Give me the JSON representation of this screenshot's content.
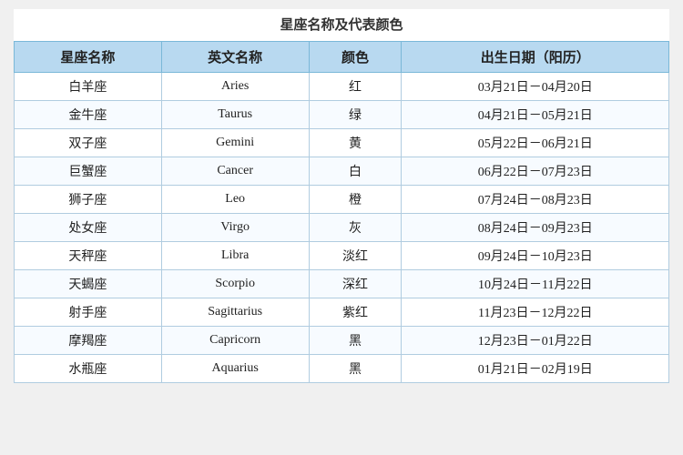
{
  "page": {
    "title": "星座名称及代表颜色",
    "headers": [
      "星座名称",
      "英文名称",
      "颜色",
      "出生日期（阳历）"
    ],
    "rows": [
      {
        "chinese": "白羊座",
        "english": "Aries",
        "color": "红",
        "dates": "03月21日－04月20日"
      },
      {
        "chinese": "金牛座",
        "english": "Taurus",
        "color": "绿",
        "dates": "04月21日－05月21日"
      },
      {
        "chinese": "双子座",
        "english": "Gemini",
        "color": "黄",
        "dates": "05月22日－06月21日"
      },
      {
        "chinese": "巨蟹座",
        "english": "Cancer",
        "color": "白",
        "dates": "06月22日－07月23日"
      },
      {
        "chinese": "狮子座",
        "english": "Leo",
        "color": "橙",
        "dates": "07月24日－08月23日"
      },
      {
        "chinese": "处女座",
        "english": "Virgo",
        "color": "灰",
        "dates": "08月24日－09月23日"
      },
      {
        "chinese": "天秤座",
        "english": "Libra",
        "color": "淡红",
        "dates": "09月24日－10月23日"
      },
      {
        "chinese": "天蝎座",
        "english": "Scorpio",
        "color": "深红",
        "dates": "10月24日－11月22日"
      },
      {
        "chinese": "射手座",
        "english": "Sagittarius",
        "color": "紫红",
        "dates": "11月23日－12月22日"
      },
      {
        "chinese": "摩羯座",
        "english": "Capricorn",
        "color": "黑",
        "dates": "12月23日－01月22日"
      },
      {
        "chinese": "水瓶座",
        "english": "Aquarius",
        "color": "黑",
        "dates": "01月21日－02月19日"
      }
    ]
  }
}
